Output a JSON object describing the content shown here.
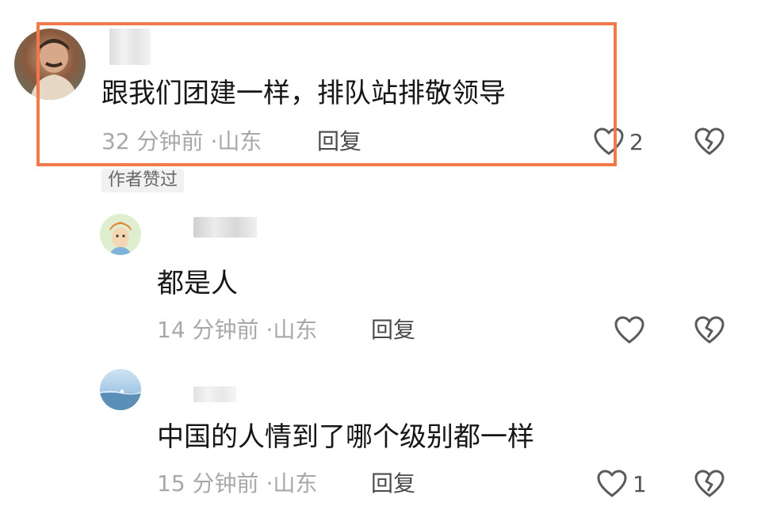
{
  "comments": [
    {
      "text": "跟我们团建一样，排队站排敬领导",
      "time": "32 分钟前",
      "location": "山东",
      "reply_label": "回复",
      "like_count": "2",
      "badge": "作者赞过",
      "highlighted": true
    },
    {
      "text": "都是人",
      "time": "14 分钟前",
      "location": "山东",
      "reply_label": "回复",
      "like_count": "",
      "highlighted": false
    },
    {
      "text": "中国的人情到了哪个级别都一样",
      "time": "15 分钟前",
      "location": "山东",
      "reply_label": "回复",
      "like_count": "1",
      "highlighted": false
    }
  ],
  "separator": "·",
  "colors": {
    "highlight_border": "#f07a4c",
    "meta_text": "#a8a8a8"
  }
}
